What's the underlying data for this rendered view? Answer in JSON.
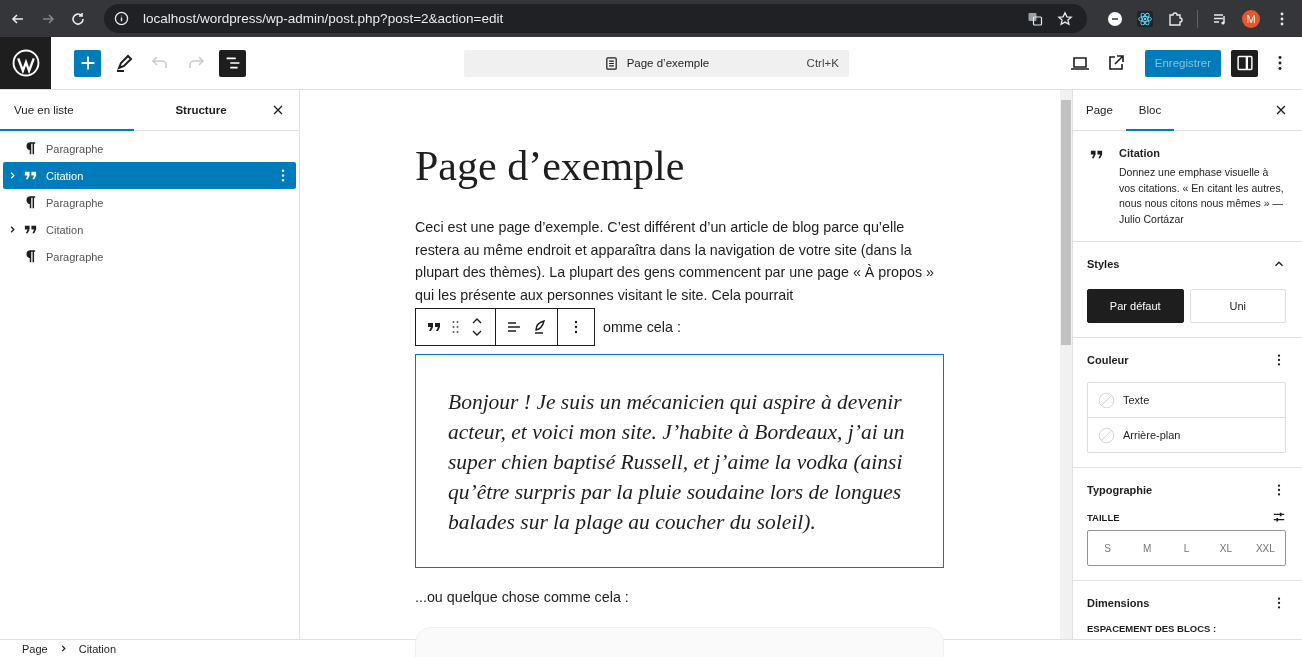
{
  "browser": {
    "url": "localhost/wordpress/wp-admin/post.php?post=2&action=edit",
    "profile_initial": "M"
  },
  "header": {
    "list_view_active": true,
    "document_title": "Page d’exemple",
    "shortcut": "Ctrl+K",
    "save_label": "Enregistrer",
    "save_disabled": true,
    "settings_active": true
  },
  "list_view": {
    "tabs": [
      {
        "label": "Vue en liste",
        "selected": true
      },
      {
        "label": "Structure",
        "selected": false
      }
    ],
    "items": [
      {
        "kind": "paragraph",
        "label": "Paragraphe",
        "selected": false,
        "expandable": false
      },
      {
        "kind": "quote",
        "label": "Citation",
        "selected": true,
        "expandable": true
      },
      {
        "kind": "paragraph",
        "label": "Paragraphe",
        "selected": false,
        "expandable": false
      },
      {
        "kind": "quote",
        "label": "Citation",
        "selected": false,
        "expandable": true
      },
      {
        "kind": "paragraph",
        "label": "Paragraphe",
        "selected": false,
        "expandable": false
      }
    ]
  },
  "editor": {
    "title": "Page d’exemple",
    "paragraph": "Ceci est une page d’exemple. C’est différent d’un article de blog parce qu’elle restera au même endroit et apparaîtra dans la navigation de votre site (dans la plupart des thèmes). La plupart des gens commencent par une page « À propos » qui les présente aux personnes visitant le site. Cela pourrait",
    "paragraph_tail": "omme cela :",
    "quote": "Bonjour ! Je suis un mécanicien qui aspire à devenir acteur, et voici mon site. J’habite à Bordeaux, j’ai un super chien baptisé Russell, et j’aime la vodka (ainsi qu’être surpris par la pluie soudaine lors de longues balades sur la plage au coucher du soleil).",
    "after_quote": "...ou quelque chose comme cela :"
  },
  "sidebar": {
    "tabs": [
      {
        "label": "Page",
        "selected": false
      },
      {
        "label": "Bloc",
        "selected": true
      }
    ],
    "block": {
      "title": "Citation",
      "description": "Donnez une emphase visuelle à vos citations. « En citant les autres, nous nous citons nous mêmes » — Julio Cortázar"
    },
    "styles": {
      "title": "Styles",
      "expanded": true,
      "options": [
        {
          "label": "Par défaut",
          "selected": true
        },
        {
          "label": "Uni",
          "selected": false
        }
      ]
    },
    "color": {
      "title": "Couleur",
      "items": [
        {
          "label": "Texte"
        },
        {
          "label": "Arrière-plan"
        }
      ]
    },
    "typography": {
      "title": "Typographie",
      "size_label": "TAILLE",
      "sizes": [
        {
          "label": "S",
          "selected": false
        },
        {
          "label": "M",
          "selected": false
        },
        {
          "label": "L",
          "selected": false
        },
        {
          "label": "XL",
          "selected": false
        },
        {
          "label": "XXL",
          "selected": false
        }
      ]
    },
    "dimensions": {
      "title": "Dimensions",
      "label": "ESPACEMENT DES BLOCS :"
    }
  },
  "breadcrumb": [
    "Page",
    "Citation"
  ]
}
